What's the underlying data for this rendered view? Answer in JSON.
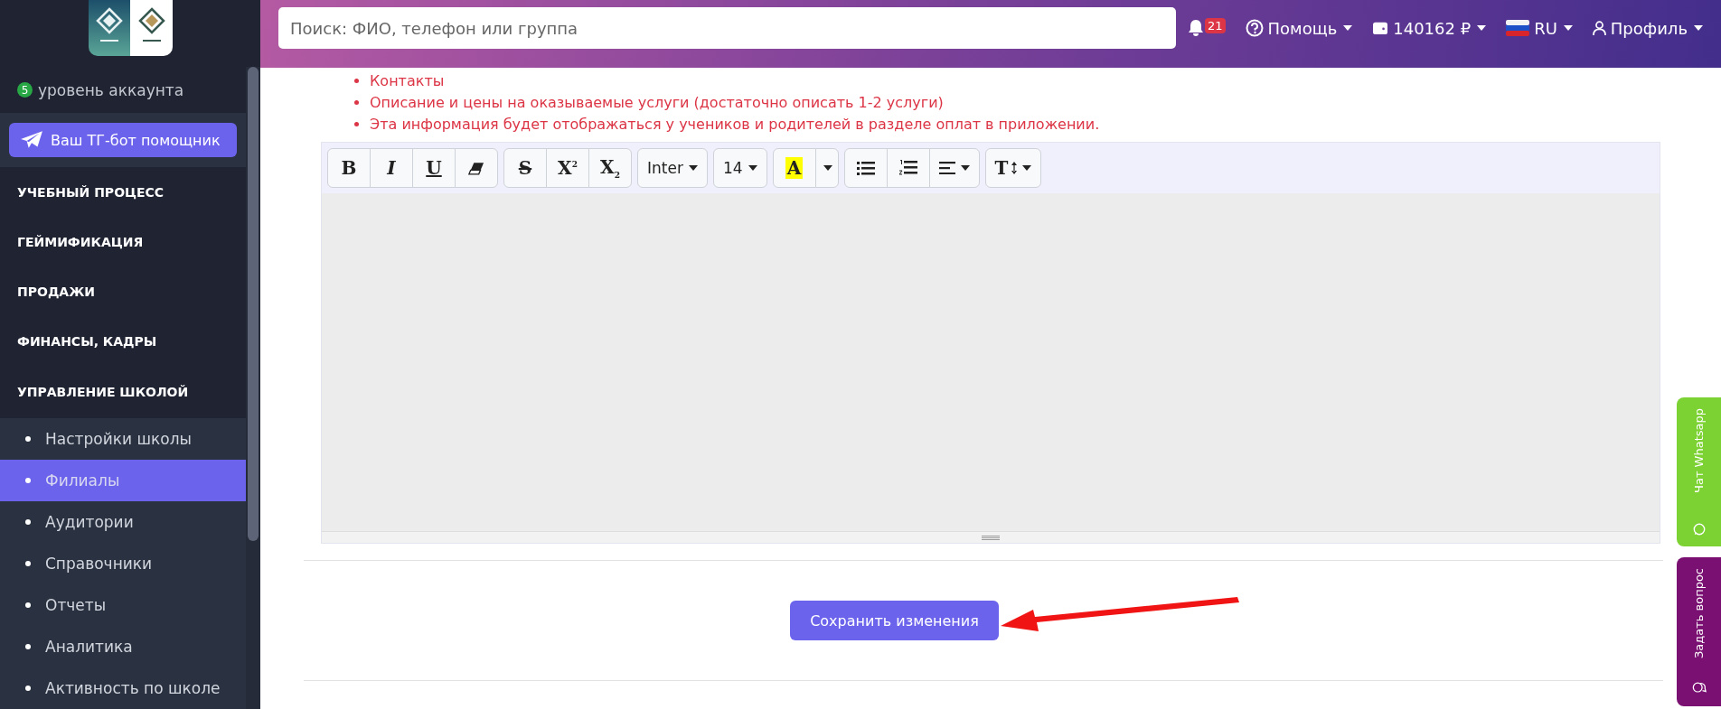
{
  "sidebar": {
    "account_level": {
      "badge": "5",
      "label": "уровень аккаунта"
    },
    "bot_button": "Ваш ТГ-бот помощник",
    "sections": [
      {
        "label": "УЧЕБНЫЙ ПРОЦЕСС",
        "expanded": false
      },
      {
        "label": "ГЕЙМИФИКАЦИЯ",
        "expanded": false
      },
      {
        "label": "ПРОДАЖИ",
        "expanded": false
      },
      {
        "label": "ФИНАНСЫ, КАДРЫ",
        "expanded": false
      },
      {
        "label": "УПРАВЛЕНИЕ ШКОЛОЙ",
        "expanded": true,
        "children": [
          {
            "label": "Настройки школы",
            "selected": false
          },
          {
            "label": "Филиалы",
            "selected": true
          },
          {
            "label": "Аудитории",
            "selected": false
          },
          {
            "label": "Справочники",
            "selected": false
          },
          {
            "label": "Отчеты",
            "selected": false
          },
          {
            "label": "Аналитика",
            "selected": false
          },
          {
            "label": "Активность по школе",
            "selected": false
          }
        ]
      }
    ]
  },
  "topbar": {
    "search": {
      "placeholder": "Поиск: ФИО, телефон или группа"
    },
    "notifications": {
      "count": "21"
    },
    "help": "Помощь",
    "balance": "140162 ₽",
    "language": "RU",
    "profile": "Профиль"
  },
  "content": {
    "notes": [
      "Контакты",
      "Описание и цены на оказываемые услуги (достаточно описать 1-2 услуги)",
      "Эта информация будет отображаться у учеников и родителей в разделе оплат в приложении."
    ],
    "editor": {
      "toolbar": [
        [
          {
            "kind": "bold",
            "label": "B"
          },
          {
            "kind": "italic",
            "label": "I"
          },
          {
            "kind": "underline",
            "label": "U"
          },
          {
            "kind": "eraser"
          }
        ],
        [
          {
            "kind": "strikethrough",
            "label": "S"
          },
          {
            "kind": "superscript",
            "label": "X$^{2}$"
          },
          {
            "kind": "subscript",
            "label": "X$_{2}$"
          }
        ],
        [
          {
            "kind": "font",
            "label": "Inter"
          }
        ],
        [
          {
            "kind": "size",
            "label": "14"
          }
        ],
        [
          {
            "kind": "color",
            "label": "A"
          },
          {
            "kind": "color-menu"
          }
        ],
        [
          {
            "kind": "bullet-list"
          },
          {
            "kind": "numbered-list"
          },
          {
            "kind": "align"
          }
        ],
        [
          {
            "kind": "line-height",
            "label": "T"
          }
        ]
      ]
    },
    "save_button": "Сохранить изменения"
  },
  "side_tabs": [
    {
      "label": "Чат Whatsapp",
      "kind": "whatsapp",
      "color": "#7bd232"
    },
    {
      "label": "Задать вопрос",
      "kind": "question",
      "color": "#7a1072"
    }
  ]
}
